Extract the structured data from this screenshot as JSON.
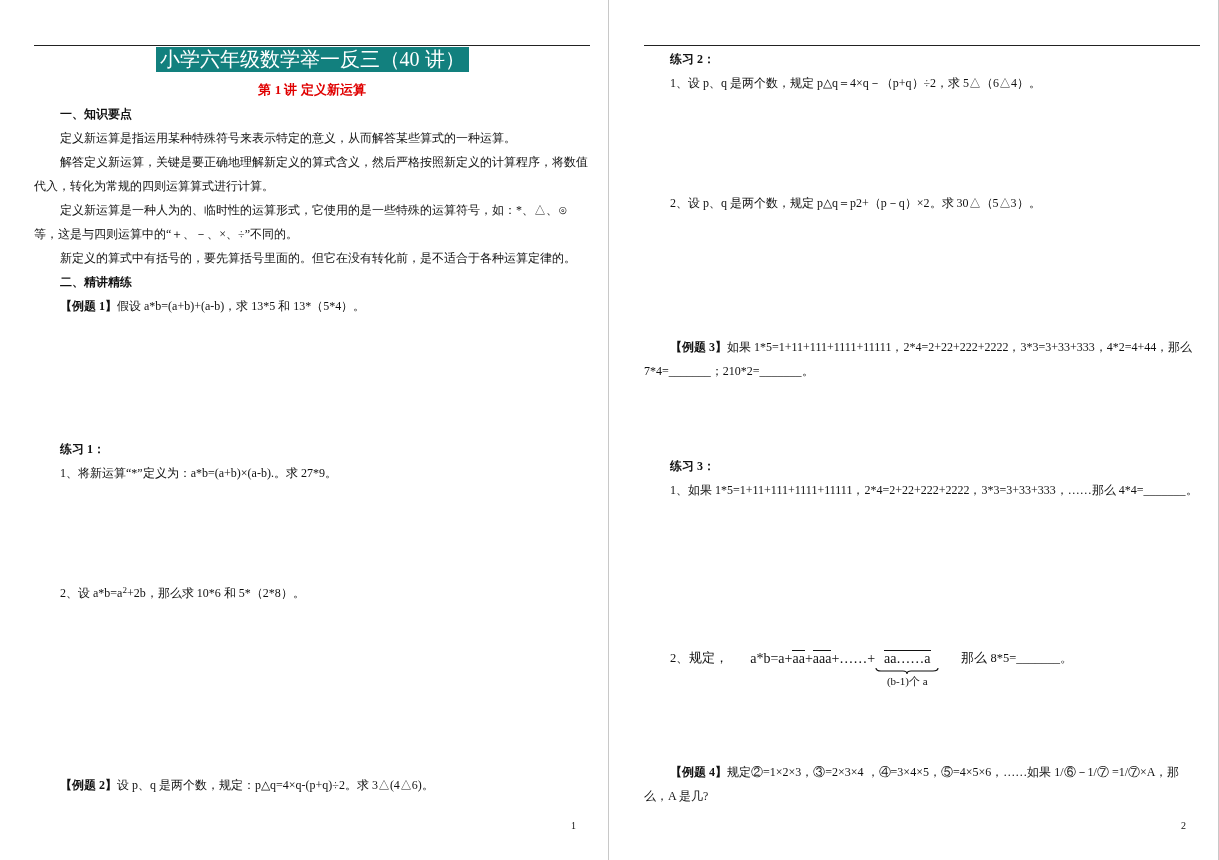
{
  "pages": [
    {
      "number": "1",
      "blocks": [
        {
          "kind": "title",
          "text": "小学六年级数学举一反三（40 讲）"
        },
        {
          "kind": "subtitle",
          "text": "第 1 讲  定义新运算"
        },
        {
          "kind": "heading",
          "text": "一、知识要点"
        },
        {
          "kind": "para",
          "text": "定义新运算是指运用某种特殊符号来表示特定的意义，从而解答某些算式的一种运算。"
        },
        {
          "kind": "para",
          "text": "解答定义新运算，关键是要正确地理解新定义的算式含义，然后严格按照新定义的计算程序，将数值代入，转化为常规的四则运算算式进行计算。"
        },
        {
          "kind": "para",
          "text": "定义新运算是一种人为的、临时性的运算形式，它使用的是一些特殊的运算符号，如：*、△、⊙等，这是与四则运算中的“＋、－、×、÷”不同的。"
        },
        {
          "kind": "para",
          "text": "新定义的算式中有括号的，要先算括号里面的。但它在没有转化前，是不适合于各种运算定律的。"
        },
        {
          "kind": "heading",
          "text": "二、精讲精练"
        },
        {
          "kind": "para",
          "text": "**【例题 1】**假设 a*b=(a+b)+(a-b)，求 13*5 和 13*（5*4）。"
        },
        {
          "kind": "heading",
          "text": "练习 1："
        },
        {
          "kind": "para",
          "text": "1、将新运算“*”定义为：a*b=(a+b)×(a-b).。求 27*9。"
        },
        {
          "kind": "para",
          "text": "2、设 a*b=a$^{2}$+2b，那么求 10*6 和 5*（2*8）。"
        },
        {
          "kind": "para",
          "text": "**【例题 2】**设 p、q 是两个数，规定：p△q=4×q-(p+q)÷2。求 3△(4△6)。"
        }
      ]
    },
    {
      "number": "2",
      "blocks": [
        {
          "kind": "heading",
          "text": "练习 2："
        },
        {
          "kind": "para",
          "text": "1、设 p、q 是两个数，规定 p△q＝4×q－（p+q）÷2，求 5△（6△4）。"
        },
        {
          "kind": "para",
          "text": "2、设 p、q 是两个数，规定 p△q＝p2+（p－q）×2。求 30△（5△3）。"
        },
        {
          "kind": "para",
          "text": "**【例题 3】**如果 1*5=1+11+111+1111+11111，2*4=2+22+222+2222，3*3=3+33+333，4*2=4+44，那么 7*4=_______；210*2=_______。"
        },
        {
          "kind": "heading",
          "text": "练习 3："
        },
        {
          "kind": "para",
          "text": "1、如果 1*5=1+11+111+1111+11111，2*4=2+22+222+2222，3*3=3+33+333，……那么 4*4=_______。"
        },
        {
          "kind": "formula",
          "prefix": "2、规定，",
          "parts": [
            {
              "text": "a*b=a+",
              "overline": false
            },
            {
              "text": "aa",
              "overline": true
            },
            {
              "text": "+",
              "overline": false
            },
            {
              "text": "aaa",
              "overline": true
            },
            {
              "text": "+……+",
              "overline": false
            },
            {
              "text": "aa……a",
              "overline": true,
              "brace_label": "(b-1)个 a"
            }
          ],
          "suffix": "那么 8*5=_______。"
        },
        {
          "kind": "para",
          "text": "**【例题 4】**规定②=1×2×3，③=2×3×4 ，④=3×4×5，⑤=4×5×6，……如果 1/⑥－1/⑦ =1/⑦×A，那么，A 是几?"
        }
      ]
    }
  ]
}
